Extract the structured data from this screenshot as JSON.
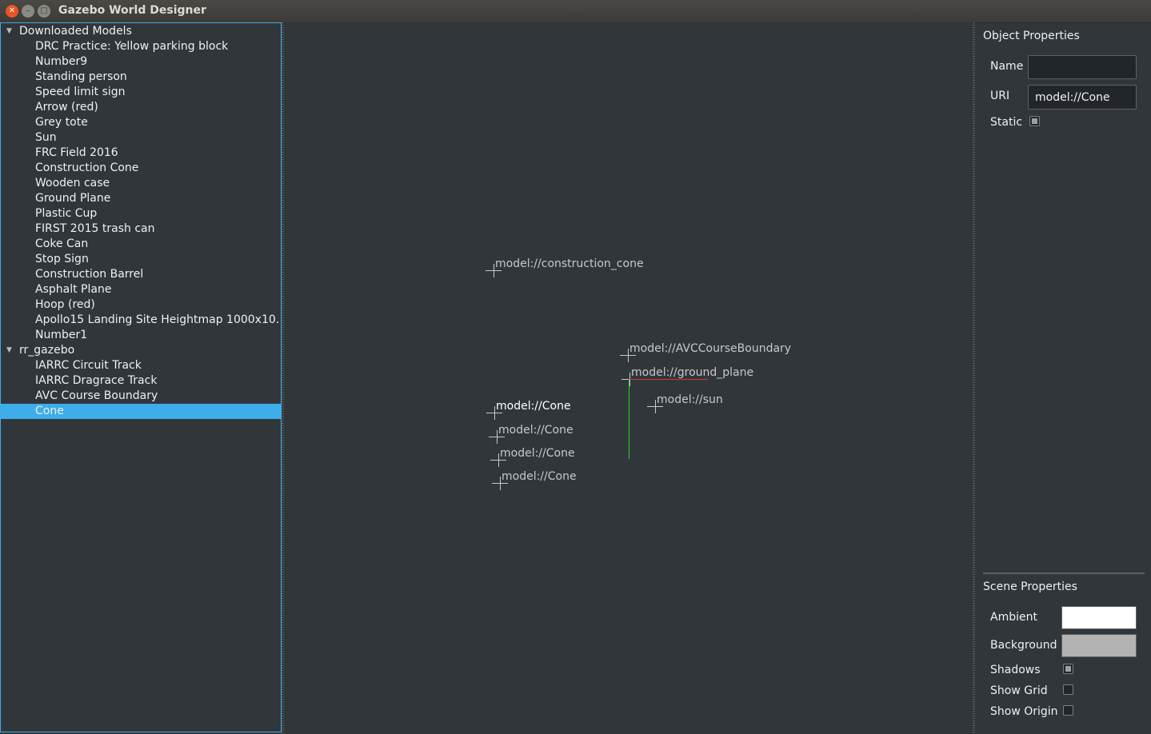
{
  "window": {
    "title": "Gazebo World Designer"
  },
  "tree": {
    "groups": [
      {
        "label": "Downloaded Models",
        "items": [
          "DRC Practice: Yellow parking block",
          "Number9",
          "Standing person",
          "Speed limit sign",
          "Arrow (red)",
          "Grey tote",
          "Sun",
          "FRC Field 2016",
          "Construction Cone",
          "Wooden case",
          "Ground Plane",
          "Plastic Cup",
          "FIRST 2015 trash can",
          "Coke Can",
          "Stop Sign",
          "Construction Barrel",
          "Asphalt Plane",
          "Hoop (red)",
          "Apollo15 Landing Site Heightmap 1000x10…",
          "Number1"
        ]
      },
      {
        "label": "rr_gazebo",
        "items": [
          "IARRC Circuit Track",
          "IARRC Dragrace Track",
          "AVC Course Boundary",
          "Cone"
        ]
      }
    ],
    "selected": "Cone"
  },
  "scene_labels": {
    "construction_cone": "model://construction_cone",
    "avc_boundary": "model://AVCCourseBoundary",
    "ground_plane": "model://ground_plane",
    "sun": "model://sun",
    "cone1": "model://Cone",
    "cone2": "model://Cone",
    "cone3": "model://Cone",
    "cone4": "model://Cone"
  },
  "object_properties": {
    "title": "Object Properties",
    "name_label": "Name",
    "name_value": "",
    "uri_label": "URI",
    "uri_value": "model://Cone",
    "static_label": "Static",
    "static_checked": true
  },
  "scene_properties": {
    "title": "Scene Properties",
    "ambient_label": "Ambient",
    "ambient_color": "#ffffff",
    "background_label": "Background",
    "background_color": "#b3b3b3",
    "shadows_label": "Shadows",
    "shadows_checked": true,
    "show_grid_label": "Show Grid",
    "show_grid_checked": false,
    "show_origin_label": "Show Origin",
    "show_origin_checked": false
  },
  "colors": {
    "accent": "#3daee9",
    "background": "#31363b",
    "x_axis": "#dd3333",
    "y_axis": "#2fd42f"
  }
}
